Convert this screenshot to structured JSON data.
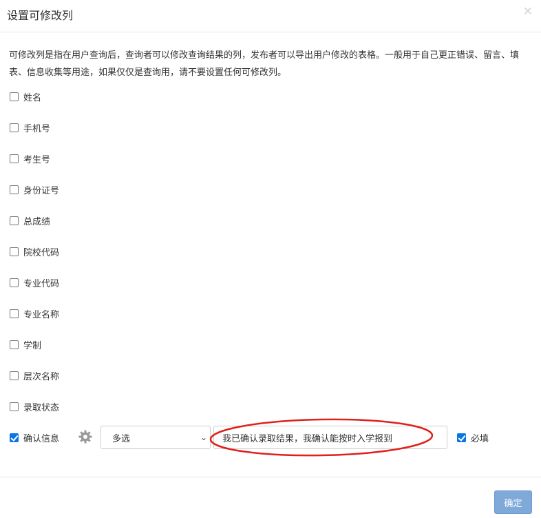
{
  "dialog": {
    "title": "设置可修改列",
    "close": "×"
  },
  "description": "可修改列是指在用户查询后，查询者可以修改查询结果的列，发布者可以导出用户修改的表格。一般用于自己更正错误、留言、填表、信息收集等用途，如果仅仅是查询用，请不要设置任何可修改列。",
  "columns": [
    {
      "label": "姓名",
      "checked": false
    },
    {
      "label": "手机号",
      "checked": false
    },
    {
      "label": "考生号",
      "checked": false
    },
    {
      "label": "身份证号",
      "checked": false
    },
    {
      "label": "总成绩",
      "checked": false
    },
    {
      "label": "院校代码",
      "checked": false
    },
    {
      "label": "专业代码",
      "checked": false
    },
    {
      "label": "专业名称",
      "checked": false
    },
    {
      "label": "学制",
      "checked": false
    },
    {
      "label": "层次名称",
      "checked": false
    },
    {
      "label": "录取状态",
      "checked": false
    },
    {
      "label": "确认信息",
      "checked": true
    }
  ],
  "confirm_row": {
    "type_select": "多选",
    "option_text": "我已确认录取结果，我确认能按时入学报到",
    "required_label": "必填",
    "required_checked": true
  },
  "footer": {
    "ok_label": "确定"
  },
  "annotation_color": "#e0201b"
}
